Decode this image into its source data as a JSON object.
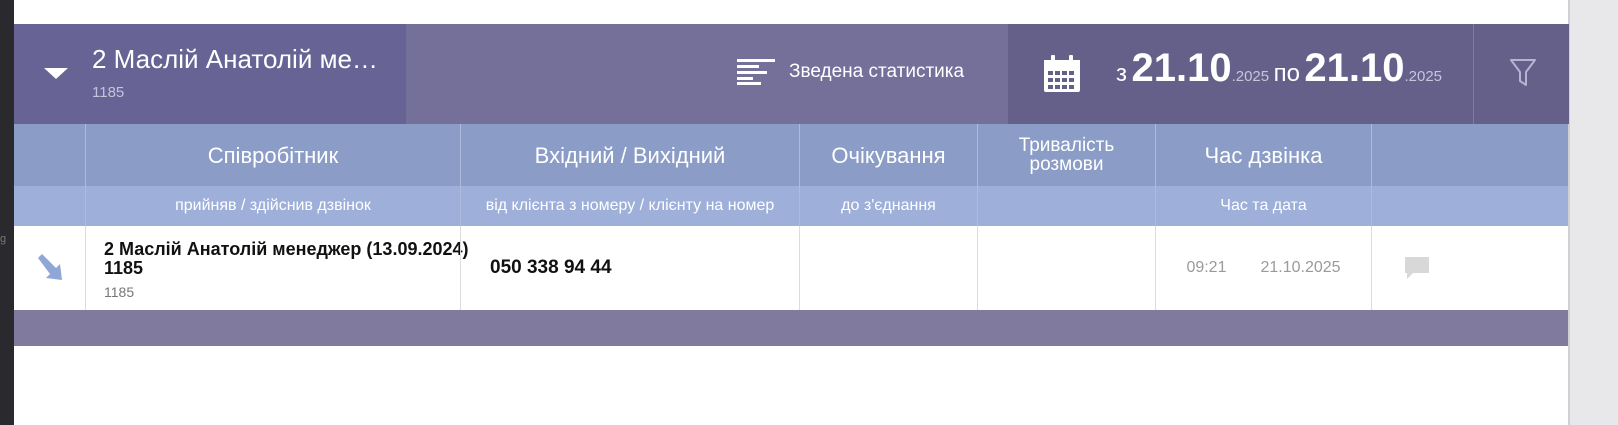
{
  "header": {
    "user_name": "2 Маслій Анатолій ме…",
    "user_id": "1185",
    "stats_label": "Зведена статистика",
    "date_from_prefix": "з",
    "date_from": "21.10",
    "date_from_year": ".2025",
    "date_to_prefix": "по",
    "date_to": "21.10",
    "date_to_year": ".2025",
    "icons": {
      "caret": "caret-down-icon",
      "stats": "bar-chart-icon",
      "calendar": "calendar-icon",
      "filter": "filter-icon"
    }
  },
  "table": {
    "columns": [
      {
        "title": "Співробітник",
        "subtitle": "прийняв / здійснив дзвінок"
      },
      {
        "title": "Вхідний / Вихідний",
        "subtitle": "від клієнта з номеру / клієнту на номер"
      },
      {
        "title": "Очікування",
        "subtitle": "до з'єднання"
      },
      {
        "title": "Тривалість розмови",
        "subtitle": ""
      },
      {
        "title": "Час дзвінка",
        "subtitle": "Час та дата"
      }
    ],
    "rows": [
      {
        "direction_icon": "incoming-arrow-icon",
        "employee_name": "2 Маслій Анатолій менеджер (13.09.2024) 1185",
        "employee_id": "1185",
        "phone": "050 338 94 44",
        "wait": "",
        "duration": "",
        "time": "09:21",
        "date": "21.10.2025",
        "comment_icon": "comment-icon"
      }
    ]
  },
  "colors": {
    "header_bg": "#74709a",
    "header_user_bg": "#676394",
    "header_date_bg": "#646089",
    "table_header_bg": "#8b9dc7",
    "table_subheader_bg": "#9eb0d9",
    "footer_bg": "#817a9f"
  }
}
